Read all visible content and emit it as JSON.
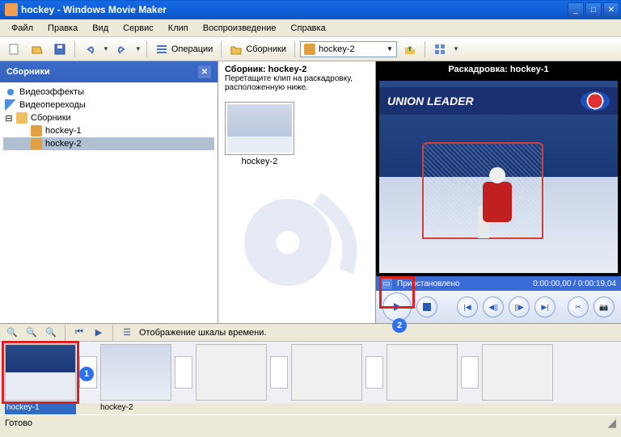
{
  "title": "hockey - Windows Movie Maker",
  "menu": [
    "Файл",
    "Правка",
    "Вид",
    "Сервис",
    "Клип",
    "Воспроизведение",
    "Справка"
  ],
  "toolbar": {
    "operations": "Операции",
    "collections": "Сборники",
    "combo_value": "hockey-2"
  },
  "left": {
    "header": "Сборники",
    "items": {
      "effects": "Видеоэффекты",
      "transitions": "Видеопереходы",
      "collections": "Сборники",
      "h1": "hockey-1",
      "h2": "hockey-2"
    }
  },
  "mid": {
    "title": "Сборник: hockey-2",
    "hint": "Перетащите клип на раскадровку, расположенную ниже.",
    "clip": "hockey-2"
  },
  "preview": {
    "title": "Раскадровка: hockey-1",
    "status": "Приостановлено",
    "time": "0:00:00,00 / 0:00:19,04",
    "banner_left": "UNION LEADER",
    "banner_right": "pepsi"
  },
  "timeline_label": "Отображение шкалы времени.",
  "storyboard": {
    "c1": "hockey-1",
    "c2": "hockey-2"
  },
  "status": "Готово",
  "badges": {
    "one": "1",
    "two": "2"
  }
}
